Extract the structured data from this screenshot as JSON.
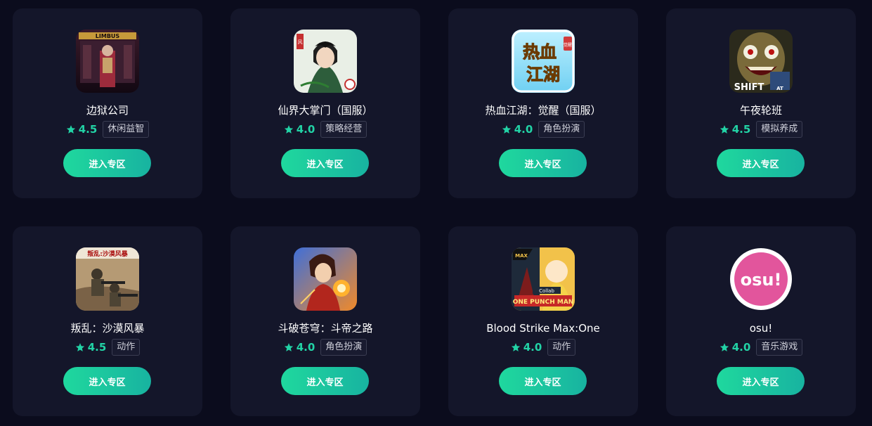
{
  "colors": {
    "background": "#0b0c1d",
    "card": "#14162a",
    "accent": "#22d3a6",
    "button_gradient": [
      "#1fd89e",
      "#18b3a0"
    ]
  },
  "games": [
    {
      "name": "边狱公司",
      "rating": "4.5",
      "tag": "休闲益智",
      "button": "进入专区",
      "icon": "limbus-company-icon"
    },
    {
      "name": "仙界大掌门（国服）",
      "rating": "4.0",
      "tag": "策略经营",
      "button": "进入专区",
      "icon": "xianjie-icon"
    },
    {
      "name": "热血江湖：觉醒（国服）",
      "rating": "4.0",
      "tag": "角色扮演",
      "button": "进入专区",
      "icon": "rexue-jianghu-icon"
    },
    {
      "name": "午夜轮班",
      "rating": "4.5",
      "tag": "模拟养成",
      "button": "进入专区",
      "icon": "night-shift-icon"
    },
    {
      "name": "叛乱：沙漠风暴",
      "rating": "4.5",
      "tag": "动作",
      "button": "进入专区",
      "icon": "insurgency-icon"
    },
    {
      "name": "斗破苍穹：斗帝之路",
      "rating": "4.0",
      "tag": "角色扮演",
      "button": "进入专区",
      "icon": "doupo-icon"
    },
    {
      "name": "Blood Strike Max:One",
      "rating": "4.0",
      "tag": "动作",
      "button": "进入专区",
      "icon": "blood-strike-icon"
    },
    {
      "name": "osu!",
      "rating": "4.0",
      "tag": "音乐游戏",
      "button": "进入专区",
      "icon": "osu-icon"
    }
  ],
  "icon_text": {
    "limbus": "LIMBUS",
    "xianjie_seal": "风",
    "rexue_line1": "热血",
    "rexue_line2": "江湖",
    "rexue_badge": "觉醒",
    "shift": "SHIFT",
    "shift_sub": "AT",
    "insurgency_banner": "叛乱:沙漠风暴",
    "blood_max": "MAX",
    "blood_collab": "Collab",
    "blood_opm": "ONE PUNCH MAN",
    "osu": "osu!"
  }
}
